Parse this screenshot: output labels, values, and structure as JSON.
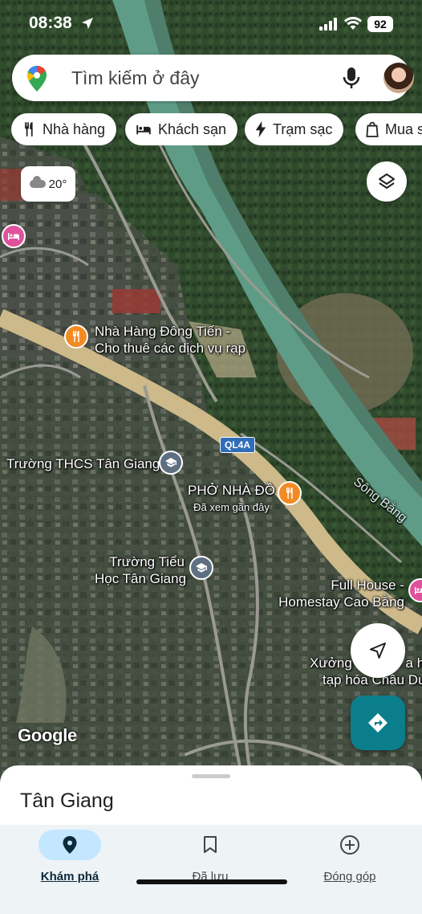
{
  "status_bar": {
    "time": "08:38",
    "battery": "92"
  },
  "search": {
    "placeholder": "Tìm kiếm ở đây"
  },
  "chips": [
    {
      "label": "Nhà hàng",
      "icon": "restaurant-icon"
    },
    {
      "label": "Khách sạn",
      "icon": "hotel-icon"
    },
    {
      "label": "Trạm sạc",
      "icon": "bolt-icon"
    },
    {
      "label": "Mua s",
      "icon": "shopping-bag-icon"
    }
  ],
  "weather": {
    "temp": "20°"
  },
  "map": {
    "road_badge": "QL4A",
    "river_label": "Sông Bằng",
    "places": {
      "dong_tien_1": "Nhà Hàng Đông Tiến -",
      "dong_tien_2": "Cho thuê các dịch vụ rạp",
      "thcs": "Trường THCS Tân Giang",
      "pho_name": "PHỞ NHÀ ĐỒ",
      "pho_note": "Đã xem gần đây",
      "tieu_hoc_1": "Trường Tiểu",
      "tieu_hoc_2": "Học Tân Giang",
      "full_house_1": "Full House -",
      "full_house_2": "Homestay Cao Bằng",
      "xuong_1": "Xưởng",
      "xuong_1b": "a h",
      "xuong_2": "tạp hóa Châu Du"
    },
    "attribution": "Google",
    "colors": {
      "poi_restaurant": "#f28b24",
      "poi_hotel": "#e0519c",
      "poi_school": "#5f6f82",
      "road": "#cdb98a",
      "river": "#5f9c87"
    }
  },
  "sheet": {
    "title": "Tân Giang"
  },
  "nav": [
    {
      "label": "Khám phá",
      "icon": "explore-pin-icon",
      "active": true
    },
    {
      "label": "Đã lưu",
      "icon": "bookmark-icon",
      "active": false
    },
    {
      "label": "Đóng góp",
      "icon": "add-circle-icon",
      "active": false
    }
  ]
}
